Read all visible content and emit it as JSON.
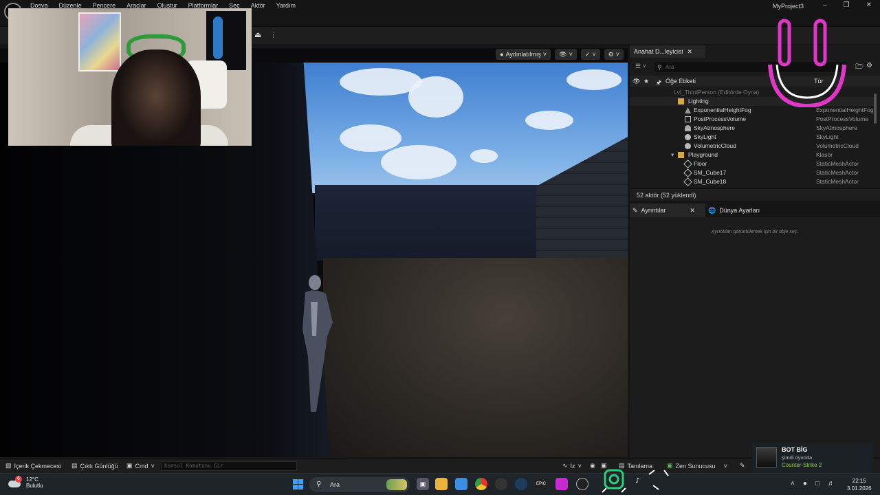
{
  "menu": [
    "Dosya",
    "Düzenle",
    "Pencere",
    "Araçlar",
    "Oluştur",
    "Platformlar",
    "Seç",
    "Aktör",
    "Yardım"
  ],
  "project_name": "MyProject3",
  "viewport": {
    "lit_mode_label": "Aydınlatılmış"
  },
  "outliner": {
    "tab_label": "Anahat D...leyicisi",
    "search_placeholder": "Ara",
    "col_label": "Öğe Etiketi",
    "col_type": "Tür",
    "rows": [
      {
        "label": "Lvl_ThirdPerson (Editörde Oyna)",
        "type": "",
        "kind": "level"
      },
      {
        "label": "Lighting",
        "type": "",
        "kind": "folder"
      },
      {
        "label": "ExponentialHeightFog",
        "type": "ExponentialHeightFog",
        "kind": "actor"
      },
      {
        "label": "PostProcessVolume",
        "type": "PostProcessVolume",
        "kind": "actor"
      },
      {
        "label": "SkyAtmosphere",
        "type": "SkyAtmosphere",
        "kind": "actor"
      },
      {
        "label": "SkyLight",
        "type": "SkyLight",
        "kind": "actor"
      },
      {
        "label": "VolumetricCloud",
        "type": "VolumetricCloud",
        "kind": "actor"
      },
      {
        "label": "Playground",
        "type": "Klasör",
        "kind": "folder"
      },
      {
        "label": "Floor",
        "type": "StaticMeshActor",
        "kind": "actor"
      },
      {
        "label": "SM_Cube17",
        "type": "StaticMeshActor",
        "kind": "actor"
      },
      {
        "label": "SM_Cube18",
        "type": "StaticMeshActor",
        "kind": "actor"
      }
    ],
    "status": "52 aktör (52 yüklendi)"
  },
  "details": {
    "tab_details": "Ayrıntılar",
    "tab_world": "Dünya Ayarları",
    "empty_message": "Ayrıntıları görüntülemek için bir obje seç."
  },
  "statusbar": {
    "content_drawer": "İçerik Çekmecesi",
    "output_log": "Çıktı Günlüğü",
    "cmd": "Cmd",
    "console_placeholder": "Konsol Komutunu Gir",
    "trace": "İz",
    "diagnostics": "Tanılama",
    "zen_server": "Zen Sunucusu"
  },
  "taskbar": {
    "weather_temp": "12°C",
    "weather_cond": "Bulutlu",
    "weather_badge": "6",
    "search_label": "Ara",
    "time": "22:15",
    "date": "3.01.2026"
  },
  "steam": {
    "name": "BOT BİG",
    "status": "şimdi oyunda",
    "game": "Counter-Strike 2"
  },
  "colors": {
    "accent_pink": "#e236c8",
    "folder_yellow": "#d8a84a",
    "steam_green": "#8fd14f"
  }
}
